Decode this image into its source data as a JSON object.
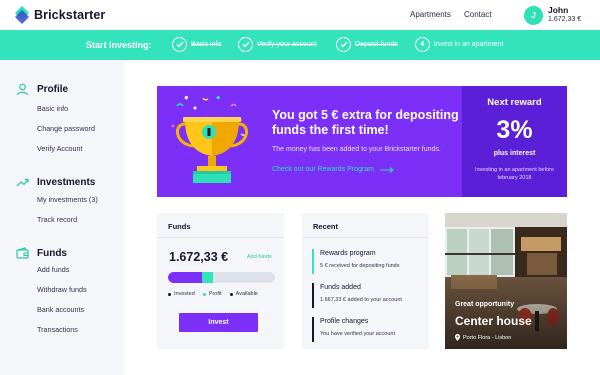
{
  "app": {
    "name": "Brickstarter"
  },
  "nav": {
    "apartments": "Apartments",
    "contact": "Contact"
  },
  "user": {
    "initial": "J",
    "name": "John",
    "funds": "1.672,33 €"
  },
  "onboarding": {
    "title": "Start investing:",
    "steps": [
      {
        "label": "Basic info",
        "done": true
      },
      {
        "label": "Verify your account",
        "done": true
      },
      {
        "label": "Deposit funds",
        "done": true
      },
      {
        "label": "Invest in an apartment",
        "number": "4",
        "done": false
      }
    ]
  },
  "sidebar": {
    "profile": {
      "title": "Profile",
      "icon": "user-icon",
      "items": [
        "Basic info",
        "Change password",
        "Verify Account"
      ]
    },
    "investments": {
      "title": "Investments",
      "icon": "trend-icon",
      "items": [
        "My investments (3)",
        "Track record"
      ]
    },
    "funds": {
      "title": "Funds",
      "icon": "wallet-icon",
      "items": [
        "Add funds",
        "Withdraw funds",
        "Bank accounts",
        "Transactions"
      ]
    }
  },
  "banner": {
    "headline": "You got 5 € extra for depositing funds the first time!",
    "subtext": "The money has been added to your Brickstarter funds.",
    "link": "Check out our Rewards Program",
    "next_reward": {
      "title": "Next reward",
      "value": "3%",
      "subtitle": "plus interest",
      "note": "Investing in an apartment before february 2018"
    }
  },
  "funds_card": {
    "title": "Funds",
    "balance": "1.672,33 €",
    "add_funds": "Add funds",
    "invested_fraction": 0.32,
    "profit_fraction": 0.1,
    "legend": [
      "Invested",
      "Profit",
      "Available"
    ],
    "button": "Invest"
  },
  "recent_card": {
    "title": "Recent",
    "items": [
      {
        "title": "Rewards program",
        "desc": "5 € received for depositing funds",
        "accent": "#33e3bb"
      },
      {
        "title": "Funds added",
        "desc": "1.667,33 € added to your account",
        "accent": "#15172a"
      },
      {
        "title": "Profile changes",
        "desc": "You have verified your account",
        "accent": "#15172a"
      }
    ]
  },
  "apartment": {
    "kicker": "Great opportunity",
    "title": "Center house",
    "location": "Porto Flora - Lisbon"
  },
  "colors": {
    "accent": "#33e3bb",
    "purple": "#7b2ff7",
    "dark": "#15172a"
  }
}
